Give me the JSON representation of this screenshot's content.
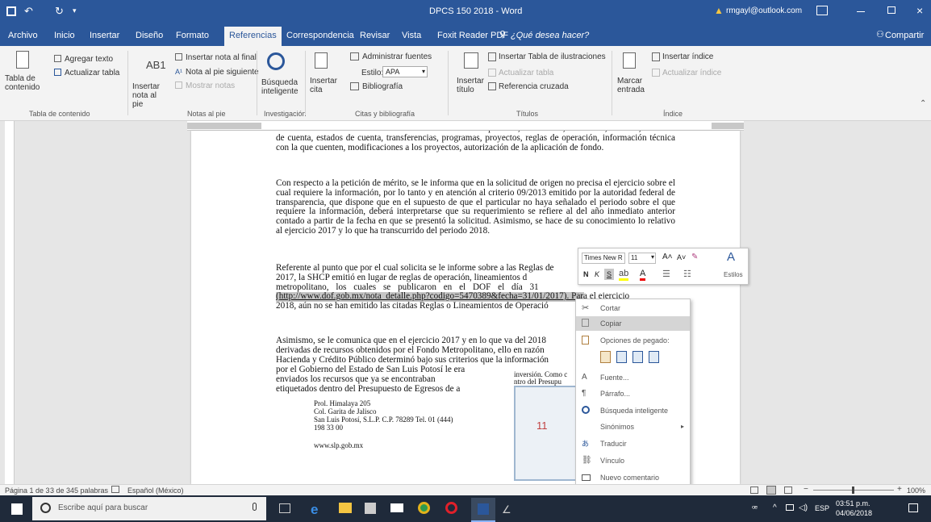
{
  "window": {
    "title": "DPCS 150 2018 - Word",
    "account": "rmgayl@outlook.com",
    "share_label": "Compartir"
  },
  "tabs": [
    "Archivo",
    "Inicio",
    "Insertar",
    "Diseño",
    "Formato",
    "Referencias",
    "Correspondencia",
    "Revisar",
    "Vista",
    "Foxit Reader PDF"
  ],
  "active_tab": "Referencias",
  "tell_me": "¿Qué desea hacer?",
  "ribbon": {
    "toc": {
      "big": "Tabla de contenido",
      "add_text": "Agregar texto",
      "update": "Actualizar tabla",
      "group": "Tabla de contenido"
    },
    "footnotes": {
      "big": "Insertar nota al pie",
      "ab": "AB1",
      "endnote": "Insertar nota al final",
      "next": "Nota al pie siguiente",
      "show": "Mostrar notas",
      "group": "Notas al pie"
    },
    "research": {
      "big": "Búsqueda inteligente",
      "group": "Investigación"
    },
    "citations": {
      "insert": "Insertar cita",
      "manage": "Administrar fuentes",
      "style_label": "Estilo:",
      "style_value": "APA",
      "biblio": "Bibliografía",
      "group": "Citas y bibliografía"
    },
    "captions": {
      "insert": "Insertar título",
      "table": "Insertar Tabla de ilustraciones",
      "update": "Actualizar tabla",
      "cross": "Referencia cruzada",
      "group": "Títulos"
    },
    "index": {
      "mark": "Marcar entrada",
      "insert": "Insertar índice",
      "update": "Actualizar índice",
      "group": "Índice"
    }
  },
  "document": {
    "p1": "conocer todos los documentos derivados del fondo metropolitano, tales como, convenios, minutas, números de cuenta, estados de cuenta, transferencias, programas, proyectos, reglas de operación, información técnica con la que cuenten, modificaciones a los proyectos, autorización de la aplicación de fondo.",
    "p2": "Con respecto a la petición de mérito, se le informa que en la solicitud de origen no precisa el ejercicio sobre el cual requiere la información, por lo tanto y en atención al criterio 09/2013 emitido por la autoridad federal de transparencia, que dispone que en el supuesto de que el particular no haya señalado el periodo sobre el que requiere la información, deberá interpretarse que su requerimiento se refiere al del año inmediato anterior contado a partir de la fecha en que se presentó la solicitud. Asimismo, se hace de su conocimiento lo relativo al ejercicio 2017 y lo que ha transcurrido del periodo 2018.",
    "p3a": "Referente al punto que por el cual solicita se le informe sobre a las Reglas de",
    "p3b": "2017, la SHCP emitió en lugar de reglas de operación, lineamientos d",
    "p3c": "metropolitano, los cuales se publicaron en el DOF el día 31",
    "p3d": "(http://www.dof.gob.mx/nota_detalle.php?codigo=5470389&fecha=31/01/2017). Para el ejercicio",
    "p3e": "2018, aún no se han emitido las citadas Reglas o Lineamientos de Operació",
    "p4a": "Asimismo, se le comunica que en el ejercicio 2017 y en lo que va del 2018",
    "p4b": "derivadas de recursos obtenidos por el Fondo Metropolitano, ello en razón",
    "p4c": "Hacienda y Crédito Público determinó bajo sus criterios que la información",
    "p4d": "por el Gobierno del Estado de San Luis Potosí le era",
    "p4e": "enviados los recursos que ya se encontraban",
    "p4f": "etiquetados dentro del Presupuesto de Egresos de a",
    "p4_side": "inversión. Como c",
    "p4_side2": "ntro del Presupu",
    "address": [
      "Prol. Himalaya 205",
      "Col. Garita de Jalisco",
      "San Luis Potosí, S.L.P. C.P. 78289 Tel. 01 (444)",
      "198 33 00"
    ],
    "web": "www.slp.gob.mx",
    "stamp_text": "11"
  },
  "minitoolbar": {
    "font": "Times New R",
    "size": "11",
    "styles": "Estilos",
    "b": "N",
    "i": "K",
    "u": "S"
  },
  "context_menu": [
    {
      "label": "Cortar",
      "icon": "scissors-icon",
      "highlight": false
    },
    {
      "label": "Copiar",
      "icon": "copy-icon",
      "highlight": true
    },
    {
      "label": "Opciones de pegado:",
      "icon": "paste-icon",
      "highlight": false,
      "header": true
    },
    {
      "label": "",
      "icon": "paste-options-icon",
      "highlight": false,
      "paste_row": true
    },
    {
      "label": "Fuente...",
      "icon": "font-icon",
      "highlight": false
    },
    {
      "label": "Párrafo...",
      "icon": "paragraph-icon",
      "highlight": false
    },
    {
      "label": "Búsqueda inteligente",
      "icon": "search-icon",
      "highlight": false
    },
    {
      "label": "Sinónimos",
      "icon": "",
      "highlight": false,
      "submenu": true
    },
    {
      "label": "Traducir",
      "icon": "translate-icon",
      "highlight": false
    },
    {
      "label": "Vínculo",
      "icon": "link-icon",
      "highlight": false
    },
    {
      "label": "Nuevo comentario",
      "icon": "comment-icon",
      "highlight": false
    }
  ],
  "status": {
    "page": "Página 1 de 3",
    "words": "3 de 345 palabras",
    "lang": "Español (México)",
    "zoom": "100%"
  },
  "taskbar": {
    "search": "Escribe aquí para buscar",
    "lang": "ESP",
    "time": "03:51 p.m.",
    "date": "04/06/2018"
  },
  "colors": {
    "word_blue": "#2b579a",
    "taskbar": "#1f2a3a"
  }
}
